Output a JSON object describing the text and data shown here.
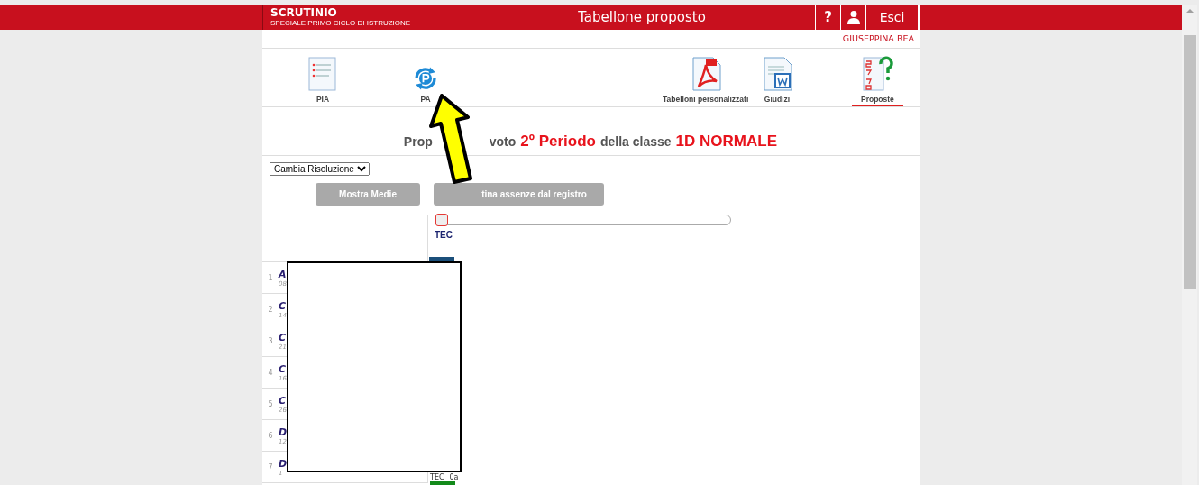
{
  "header": {
    "logo": "SCRUTINIO",
    "logo_sub": "SPECIALE PRIMO CICLO DI ISTRUZIONE",
    "title": "Tabellone proposto",
    "help": "?",
    "logout": "Esci"
  },
  "user": "GIUSEPPINA REA",
  "nav": [
    {
      "kind": "list",
      "label": "PIA",
      "selected": false
    },
    {
      "kind": "cycle",
      "label": "PA",
      "selected": false
    },
    {
      "kind": "pdf",
      "label": "Tabelloni personalizzati",
      "selected": false
    },
    {
      "kind": "word",
      "label": "Giudizi",
      "selected": false
    },
    {
      "kind": "grades",
      "label": "Proposte",
      "selected": true
    }
  ],
  "heading": {
    "part_1": "Prop",
    "part_2": "voto",
    "period": "2º Periodo",
    "middle": "della classe",
    "class": "1D NORMALE"
  },
  "resolution_select": "Cambia Risoluzione",
  "buttons": [
    {
      "label": "Mostra Medie",
      "disabled": true
    },
    {
      "label": "tina assenze dal registro",
      "disabled": true
    }
  ],
  "slider": {
    "level": 0
  },
  "column_header": "TEC",
  "rows": [
    {
      "number": "1",
      "name": "A",
      "date": "08"
    },
    {
      "number": "2",
      "name": "C",
      "date": "14"
    },
    {
      "number": "3",
      "name": "C",
      "date": "21"
    },
    {
      "number": "4",
      "name": "C",
      "date": "16"
    },
    {
      "number": "5",
      "name": "C",
      "date": "26"
    },
    {
      "number": "6",
      "name": "D",
      "date": "12"
    },
    {
      "number": "7",
      "name": "D",
      "date": "1"
    }
  ],
  "footer_cell": {
    "subject": "TEC",
    "value": "0a"
  }
}
